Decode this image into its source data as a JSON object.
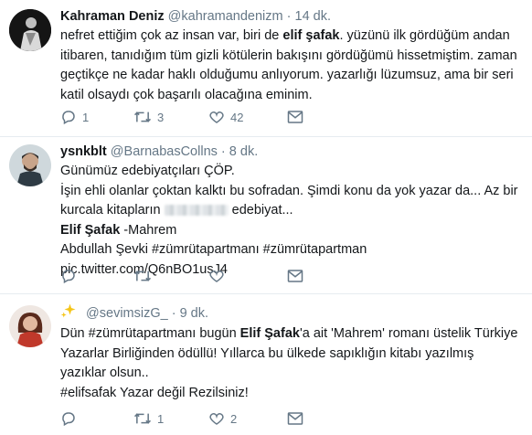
{
  "tweets": [
    {
      "name": "Kahraman Deniz",
      "handle": "@kahramandenizm",
      "separator": "·",
      "time": "14 dk.",
      "text_a": "nefret ettiğim çok az insan var, biri de ",
      "text_b": "elif şafak",
      "text_c": ". yüzünü ilk gördüğüm andan itibaren, tanıdığım tüm gizli kötülerin bakışını gördüğümü hissetmiştim. zaman geçtikçe ne kadar haklı olduğumu anlıyorum. yazarlığı lüzumsuz, ama bir seri katil olsaydı çok başarılı olacağına eminim.",
      "replies": "1",
      "retweets": "3",
      "likes": "42"
    },
    {
      "name": "ysnkblt",
      "handle": "@BarnabasCollns",
      "separator": "·",
      "time": "8 dk.",
      "line1": "Günümüz edebiyatçıları ÇÖP.",
      "line2a": " İşin ehli olanlar çoktan kalktı bu sofradan. Şimdi konu da yok yazar da... Az bir kurcala kitapların",
      "line2b": "edebiyat...",
      "book_author": "Elif Şafak",
      "book_title": " -Mahrem",
      "footer": "Abdullah Şevki #zümrütapartmanı #zümrütapartman pic.twitter.com/Q6nBO1usJ4",
      "replies": "",
      "retweets": "",
      "likes": ""
    },
    {
      "name": "",
      "handle": "@sevimsizG_",
      "separator": "·",
      "time": "9 dk.",
      "text_a": "Dün #zümrütapartmanı bugün ",
      "text_b": "Elif Şafak",
      "text_c": "'a ait 'Mahrem' romanı üstelik Türkiye Yazarlar Birliğinden ödüllü! Yıllarca bu ülkede sapıklığın kitabı yazılmış yazıklar olsun..",
      "text_d": "#elifsafak Yazar değil Rezilsiniz!",
      "replies": "",
      "retweets": "1",
      "likes": "2"
    }
  ],
  "colors": {
    "text": "#14171a",
    "muted": "#657786",
    "divider": "#e6ecf0",
    "sparkle": "#f5c518"
  }
}
